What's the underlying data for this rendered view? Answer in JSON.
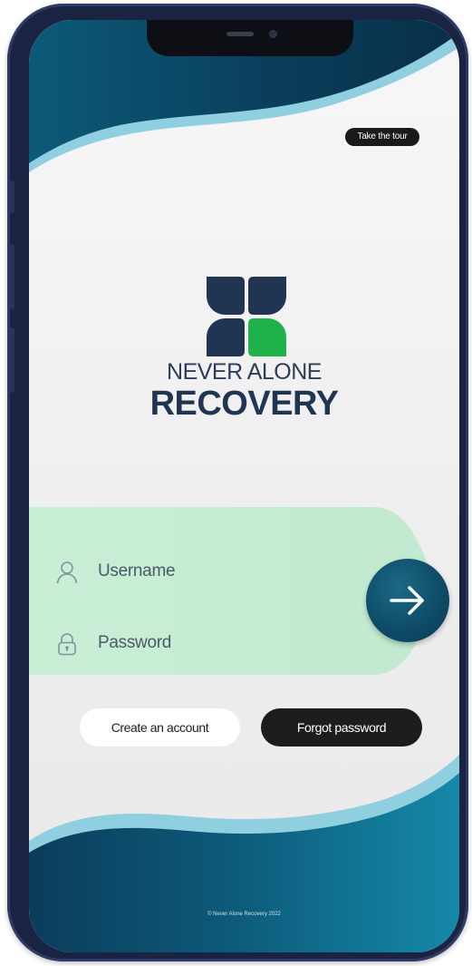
{
  "header": {
    "tour_label": "Take the tour"
  },
  "brand": {
    "line1": "NEVER ALONE",
    "line2": "RECOVERY"
  },
  "form": {
    "username_placeholder": "Username",
    "password_placeholder": "Password"
  },
  "actions": {
    "create_account_label": "Create an account",
    "forgot_password_label": "Forgot password"
  },
  "footer": {
    "copyright": "© Never Alone Recovery 2022"
  },
  "icons": {
    "user": "user-icon",
    "lock": "lock-icon",
    "submit": "arrow-right-icon",
    "logo": "clover-logo-icon"
  },
  "colors": {
    "brand_navy": "#1f3552",
    "accent_green": "#1fb14a",
    "teal": "#0d4a66",
    "mint": "#c8ecd5"
  }
}
